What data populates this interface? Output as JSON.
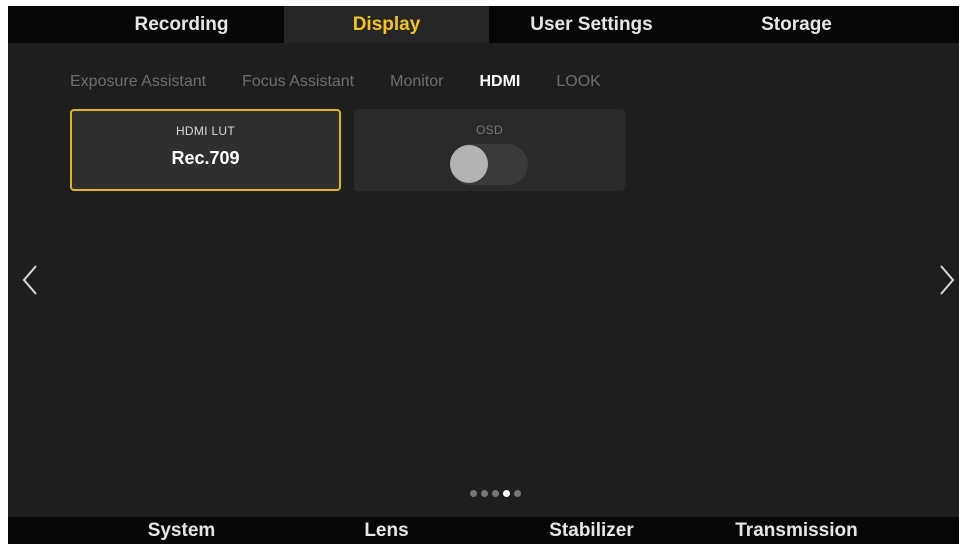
{
  "top_nav": {
    "tabs": [
      {
        "label": "Recording"
      },
      {
        "label": "Display"
      },
      {
        "label": "User Settings"
      },
      {
        "label": "Storage"
      }
    ],
    "active_index": 1
  },
  "sub_tabs": {
    "items": [
      {
        "label": "Exposure Assistant"
      },
      {
        "label": "Focus Assistant"
      },
      {
        "label": "Monitor"
      },
      {
        "label": "HDMI"
      },
      {
        "label": "LOOK"
      }
    ],
    "active_index": 3
  },
  "settings": {
    "hdmi_lut": {
      "label": "HDMI LUT",
      "value": "Rec.709",
      "selected": true
    },
    "osd": {
      "label": "OSD",
      "enabled": false
    }
  },
  "pagination": {
    "total": 5,
    "current": 4
  },
  "bottom_nav": {
    "tabs": [
      {
        "label": "System"
      },
      {
        "label": "Lens"
      },
      {
        "label": "Stabilizer"
      },
      {
        "label": "Transmission"
      }
    ]
  },
  "colors": {
    "accent": "#f5c518",
    "selection_border": "#e2b41e",
    "background": "#1e1e1e",
    "nav_background": "#070707"
  },
  "icons": {
    "prev": "chevron-left-icon",
    "next": "chevron-right-icon"
  }
}
